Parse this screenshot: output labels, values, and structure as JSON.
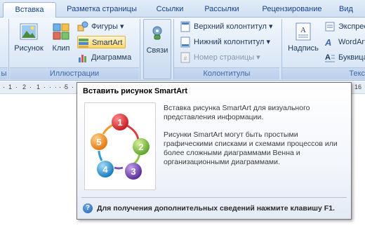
{
  "tabs": [
    "Вставка",
    "Разметка страницы",
    "Ссылки",
    "Рассылки",
    "Рецензирование",
    "Вид"
  ],
  "ribbon": {
    "groups": {
      "illustrations": "Иллюстрации",
      "headers": "Колонтитулы",
      "text": "Текс"
    },
    "buttons": {
      "picture": "Рисунок",
      "clip": "Клип",
      "shapes": "Фигуры",
      "smartart": "SmartArt",
      "chart": "Диаграмма",
      "links": "Связи",
      "header": "Верхний колонтитул",
      "footer": "Нижний колонтитул",
      "page_number": "Номер страницы",
      "textbox": "Надпись",
      "express": "Экспрес",
      "wordart": "WordArt",
      "dropcap": "Буквица"
    },
    "left_partial_label": "ы"
  },
  "ruler": {
    "ticks": [
      "·",
      "1",
      "·",
      "2",
      "·",
      "1",
      "·",
      "·",
      "·",
      "·",
      "·",
      "5",
      "·"
    ],
    "right_number": "16"
  },
  "tooltip": {
    "title": "Вставить рисунок SmartArt",
    "desc1": "Вставка рисунка SmartArt для визуального представления информации.",
    "desc2": "Рисунки SmartArt могут быть простыми графическими списками и схемами процессов или более сложными диаграммами Венна и организационными диаграммами.",
    "help": "Для получения дополнительных сведений нажмите клавишу F1.",
    "diagram_numbers": [
      "1",
      "2",
      "3",
      "4",
      "5"
    ]
  },
  "colors": {
    "accent": "#15428b",
    "circle1": "#e0393e",
    "circle2": "#8cc63f",
    "circle3": "#7b4fb5",
    "circle4": "#2e9bd6",
    "circle5": "#f29a2e"
  }
}
